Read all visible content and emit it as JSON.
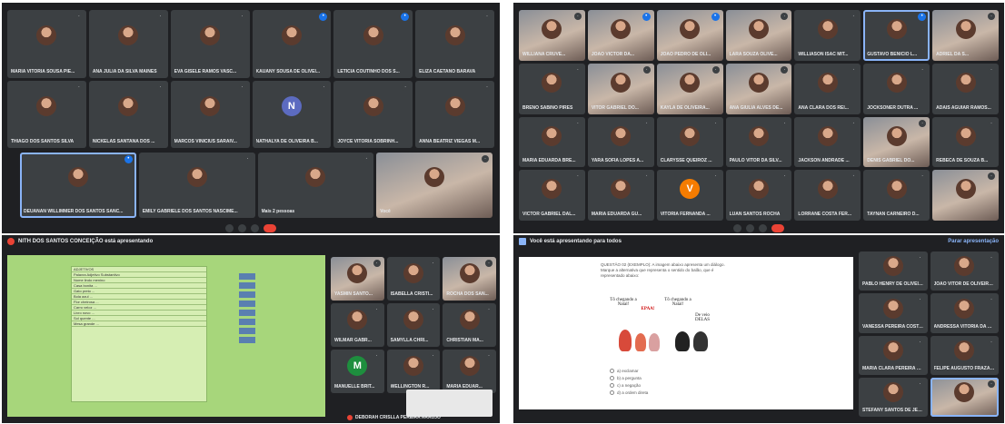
{
  "pA": {
    "tiles": [
      {
        "name": "MARIA VITÓRIA SOUSA PIE..."
      },
      {
        "name": "ANA JÚLIA DA SILVA MAINES"
      },
      {
        "name": "EVA GISELE RAMOS VASC..."
      },
      {
        "name": "KAUANY SOUSA DE OLIVEI..."
      },
      {
        "name": "LETÍCIA COUTINHO DOS S..."
      },
      {
        "name": "ELIZA CAETANO BARAVA"
      },
      {
        "name": "THIAGO DOS SANTOS SILVA"
      },
      {
        "name": "NICKELAS SANTANA DOS ..."
      },
      {
        "name": "MARCOS VINÍCIUS SARAIV..."
      },
      {
        "name": "NATHALYA DE OLIVEIRA B...",
        "letter": "N"
      },
      {
        "name": "JOYCE VITÓRIA SOBRINH..."
      },
      {
        "name": "ANNA BEATRIZ VIEGAS M..."
      }
    ],
    "bottom": [
      {
        "name": "DEUANAN WILLIMMER DOS SANTOS SANC..."
      },
      {
        "name": "EMILY GABRIELE DOS SANTOS NASCIME..."
      },
      {
        "name": "Mais 2 pessoas"
      },
      {
        "name": "Você"
      }
    ]
  },
  "pB": {
    "tiles": [
      {
        "name": "WILLIANA CRUVE..."
      },
      {
        "name": "JOÃO VICTOR DA..."
      },
      {
        "name": "JOÃO PEDRO DE OLI..."
      },
      {
        "name": "LARA SOUZA OLIVE..."
      },
      {
        "name": "WILLIASON ISAC MIT..."
      },
      {
        "name": "GUSTAVO BENÍCIO L..."
      },
      {
        "name": "ADRIEL DA S..."
      },
      {
        "name": "BRENO SABINO PIRES"
      },
      {
        "name": "VITOR GABRIEL DO..."
      },
      {
        "name": "KAYLA DE OLIVEIRA..."
      },
      {
        "name": "ANA GIULIA ALVES DE..."
      },
      {
        "name": "ANA CLARA DOS REI..."
      },
      {
        "name": "JOCKSONER DUTRA ..."
      },
      {
        "name": "ADAIS AGUIAR RAMOS..."
      },
      {
        "name": "MARIA EDUARDA BRE..."
      },
      {
        "name": "YARA SOFIA LOPES A..."
      },
      {
        "name": "CLARYSSE QUEIROZ ..."
      },
      {
        "name": "PAULO VITOR DA SILV..."
      },
      {
        "name": "JACKSON ANDRADE ..."
      },
      {
        "name": "DENIS GABRIEL DO..."
      },
      {
        "name": "REBECA DE SOUZA B..."
      },
      {
        "name": "VICTOR GABRIEL DAL..."
      },
      {
        "name": "MARIA EDUARDA GU..."
      },
      {
        "name": "VITÓRIA FERNANDA ...",
        "letter": "V"
      },
      {
        "name": "LUAN SANTOS ROCHA"
      },
      {
        "name": "LORRANE COSTA FER..."
      },
      {
        "name": "TAYNAN CARNEIRO D..."
      },
      {
        "name": ""
      }
    ]
  },
  "pC": {
    "presenter": "NITH DOS SANTOS CONCEIÇÃO está apresentando",
    "side": [
      {
        "name": "YASMIN SANTO..."
      },
      {
        "name": "ISABELLA CRISTI..."
      },
      {
        "name": "ROCHA DOS SAN..."
      },
      {
        "name": "WILMAR GABR..."
      },
      {
        "name": "SAMYLLA CHRI..."
      },
      {
        "name": "CHRISTIAN MA..."
      },
      {
        "name": "MANUELLE BRIT...",
        "letter": "M"
      },
      {
        "name": "WELLINGTON R..."
      },
      {
        "name": "MARIA EDUAR..."
      }
    ],
    "bottom_name": "DEBORAH CRISLLA PEREIRA ARAÚJO",
    "doc_rows": [
      "ADJETIVOS",
      "Palavra  Adjetivo  Substantivo",
      "Nome  lindo  menino",
      "Casa  bonita  ...",
      "Gato  preto  ...",
      "Bola  azul  ...",
      "Flor  cheirosa  ...",
      "Carro  veloz  ...",
      "Livro  novo  ...",
      "Sol  quente  ...",
      "Mesa  grande  ..."
    ]
  },
  "pD": {
    "title": "Você está apresentando para todos",
    "stop": "Parar apresentação",
    "question": "QUESTÃO 02 (EXEMPLO): A imagem abaixo apresenta um diálogo. Marque a alternativa que representa o sentido do balão, que é representado abaixo:",
    "bubble1": "Tô chegando a Natal!",
    "bubble2": "Tô chegando a Natal!",
    "exclaim": "EPAA!",
    "bubble3": "De veio DELAS",
    "options": [
      "a) exclamar",
      "b) a pergunta",
      "c) a negação",
      "d) a ordem direta"
    ],
    "side": [
      {
        "name": "PABLO HENRY DE OLIVEIR..."
      },
      {
        "name": "JOAO VITOR DE OLIVEIRA..."
      },
      {
        "name": "VANESSA PEREIRA COSTA..."
      },
      {
        "name": "ANDRESSA VITÓRIA DA SIL..."
      },
      {
        "name": "MARIA CLARA PEREIRA M..."
      },
      {
        "name": "FELIPE AUGUSTO FRAZÃO..."
      },
      {
        "name": "STEFANY SANTOS DE JESUS"
      },
      {
        "name": ""
      }
    ]
  }
}
